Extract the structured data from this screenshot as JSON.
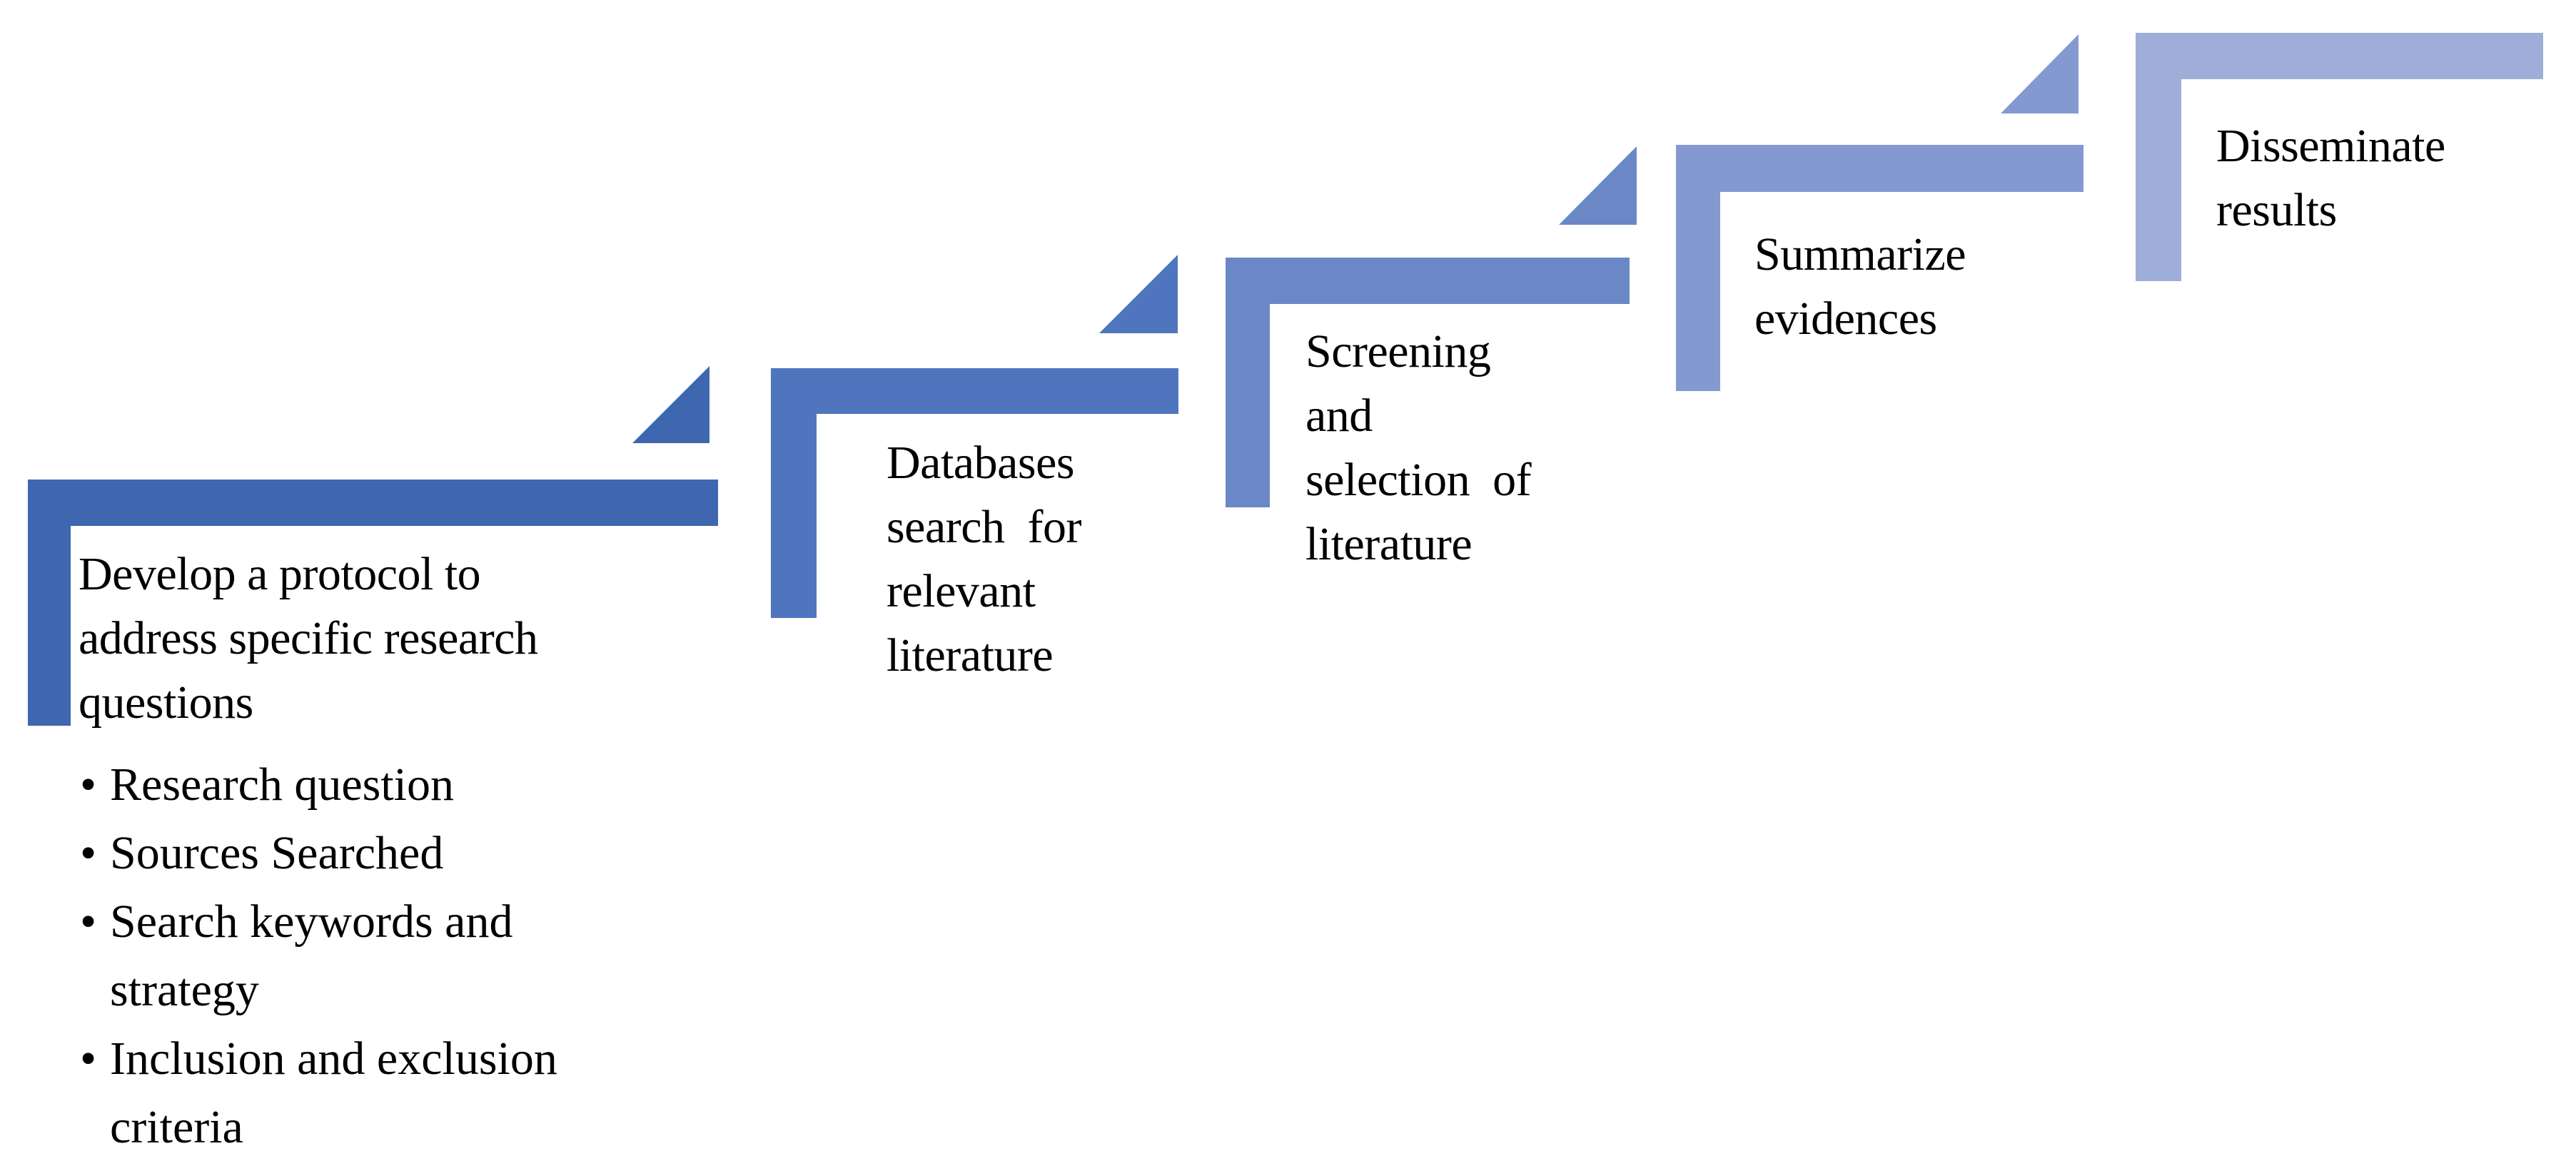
{
  "diagram": {
    "type": "staircase-process",
    "steps": [
      {
        "id": "s1",
        "color": "#3E67B0",
        "lines": [
          "Develop a protocol to",
          "address specific research",
          "questions"
        ],
        "bullets": [
          {
            "lines": [
              "Research question"
            ]
          },
          {
            "lines": [
              "Sources Searched"
            ]
          },
          {
            "lines": [
              "Search keywords and",
              "strategy"
            ]
          },
          {
            "lines": [
              "Inclusion and exclusion",
              "criteria"
            ]
          }
        ]
      },
      {
        "id": "s2",
        "color": "#4F75BE",
        "lines": [
          "Databases",
          "search  for",
          "relevant",
          "literature"
        ]
      },
      {
        "id": "s3",
        "color": "#6A88C6",
        "lines": [
          "Screening",
          "and",
          "selection  of",
          "literature"
        ]
      },
      {
        "id": "s4",
        "color": "#8499D0",
        "lines": [
          "Summarize",
          "evidences"
        ]
      },
      {
        "id": "s5",
        "color": "#9FAED9",
        "lines": [
          "Disseminate",
          "results"
        ]
      }
    ],
    "bullet_glyph": "•"
  }
}
